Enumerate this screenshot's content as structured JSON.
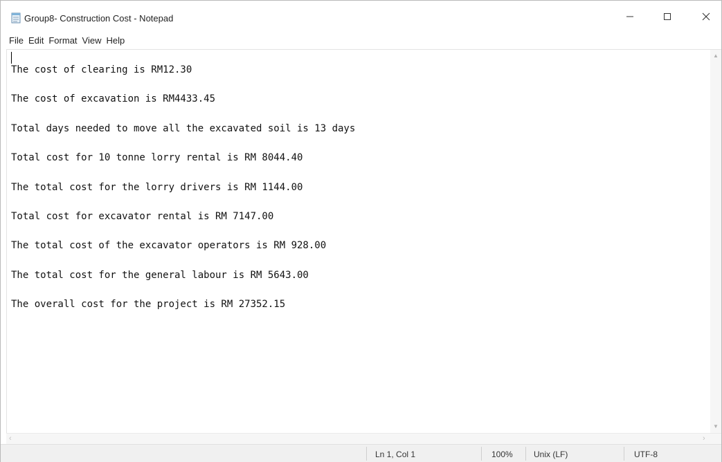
{
  "window": {
    "title": "Group8- Construction Cost - Notepad",
    "minimize_glyph": "—",
    "maximize_glyph": "☐",
    "close_glyph": "✕"
  },
  "menu": [
    {
      "label": "File"
    },
    {
      "label": "Edit"
    },
    {
      "label": "Format"
    },
    {
      "label": "View"
    },
    {
      "label": "Help"
    }
  ],
  "editor": {
    "lines": [
      "The cost of clearing is RM12.30",
      "The cost of excavation is RM4433.45",
      "Total days needed to move all the excavated soil is 13 days",
      "Total cost for 10 tonne lorry rental is RM 8044.40",
      "The total cost for the lorry drivers is RM 1144.00",
      "Total cost for excavator rental is RM 7147.00",
      "The total cost of the excavator operators is RM 928.00",
      "The total cost for the general labour is RM 5643.00",
      "The overall cost for the project is RM 27352.15"
    ]
  },
  "scrollbar": {
    "up_glyph": "▲",
    "down_glyph": "▼",
    "left_glyph": "‹",
    "right_glyph": "›"
  },
  "status": {
    "position": "Ln 1, Col 1",
    "zoom": "100%",
    "line_ending": "Unix (LF)",
    "encoding": "UTF-8"
  },
  "icons": {
    "app": "notepad-icon",
    "minimize": "minimize-icon",
    "maximize": "maximize-icon",
    "close": "close-icon"
  },
  "colors": {
    "background": "#ffffff",
    "statusbar": "#f0f0f0",
    "text": "#111111"
  }
}
